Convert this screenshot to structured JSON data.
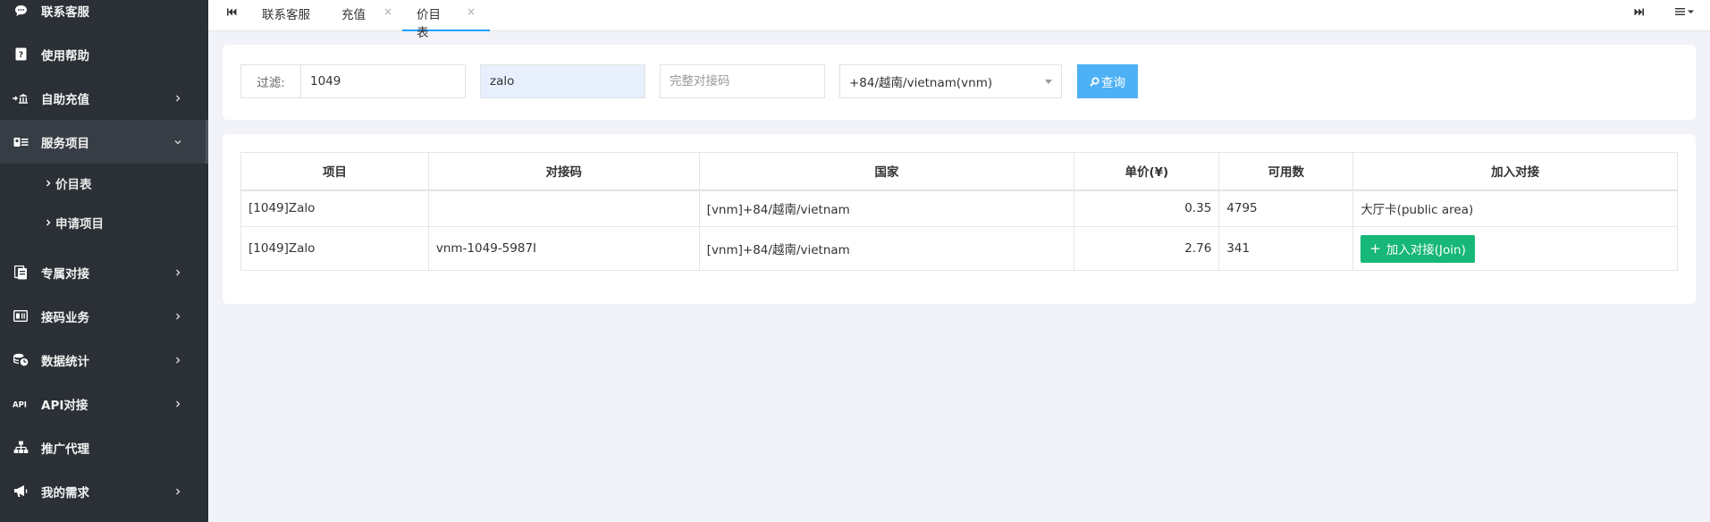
{
  "sidebar": {
    "items": [
      {
        "label": "联系客服",
        "icon": "chat-icon"
      },
      {
        "label": "使用帮助",
        "icon": "help-icon"
      },
      {
        "label": "自助充值",
        "icon": "recharge-icon"
      },
      {
        "label": "服务项目",
        "icon": "service-icon"
      },
      {
        "label": "专属对接",
        "icon": "dedicated-icon"
      },
      {
        "label": "接码业务",
        "icon": "code-business-icon"
      },
      {
        "label": "数据统计",
        "icon": "stats-icon"
      },
      {
        "label": "API对接",
        "icon": "api-icon"
      },
      {
        "label": "推广代理",
        "icon": "agent-icon"
      },
      {
        "label": "我的需求",
        "icon": "megaphone-icon"
      }
    ],
    "subitems": [
      {
        "label": "价目表"
      },
      {
        "label": "申请项目"
      }
    ]
  },
  "tabs": [
    {
      "label": "联系客服"
    },
    {
      "label": "充值",
      "close": "×"
    },
    {
      "label": "价目表",
      "close": "×"
    }
  ],
  "filter": {
    "label": "过滤:",
    "project_id": "1049",
    "project_name": "zalo",
    "code_placeholder": "完整对接码",
    "country_selected": "+84/越南/vietnam(vnm)",
    "query_label": "查询"
  },
  "table": {
    "headers": [
      "项目",
      "对接码",
      "国家",
      "单价(¥)",
      "可用数",
      "加入对接"
    ],
    "rows": [
      {
        "project": "[1049]Zalo",
        "code": "",
        "country": "[vnm]+84/越南/vietnam",
        "price": "0.35",
        "available": "4795",
        "join": "大厅卡(public area)"
      },
      {
        "project": "[1049]Zalo",
        "code": "vnm-1049-5987I",
        "country": "[vnm]+84/越南/vietnam",
        "price": "2.76",
        "available": "341",
        "join_button": "加入对接(Join)"
      }
    ]
  },
  "colors": {
    "sidebar_bg": "#2b3036",
    "primary_blue": "#4fb1f5",
    "join_green": "#16b777",
    "price_green": "#1e8a1e"
  }
}
